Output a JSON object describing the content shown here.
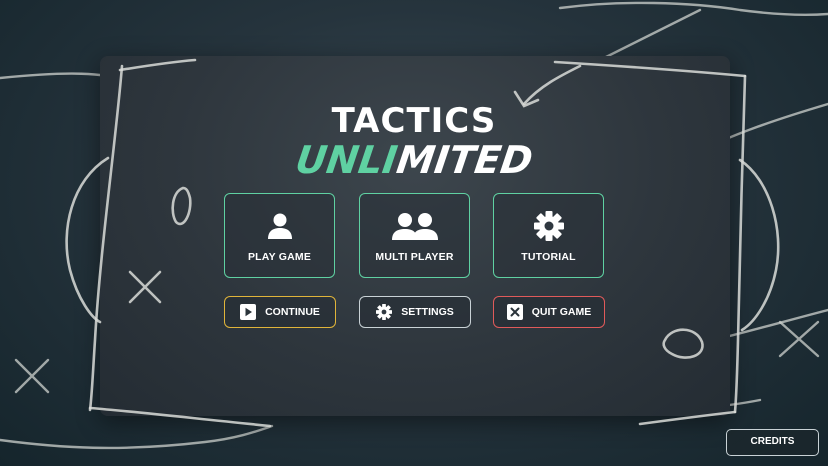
{
  "logo": {
    "line1": "TACTICS",
    "line2_part1": "UNLI",
    "line2_part2": "MITED"
  },
  "menu": {
    "tiles": [
      {
        "label": "PLAY GAME",
        "icon": "single-user-icon"
      },
      {
        "label": "MULTI PLAYER",
        "icon": "multi-user-icon"
      },
      {
        "label": "TUTORIAL",
        "icon": "gear-icon"
      }
    ],
    "buttons": [
      {
        "label": "CONTINUE",
        "icon": "play-icon",
        "border": "#e0b43a"
      },
      {
        "label": "SETTINGS",
        "icon": "gear-icon",
        "border": "#c9d2d6"
      },
      {
        "label": "QUIT GAME",
        "icon": "close-icon",
        "border": "#e05a5a"
      }
    ]
  },
  "credits_label": "CREDITS",
  "colors": {
    "accent": "#5fd1a2",
    "continue": "#e0b43a",
    "quit": "#e05a5a",
    "chalk": "#d9dcd8"
  }
}
